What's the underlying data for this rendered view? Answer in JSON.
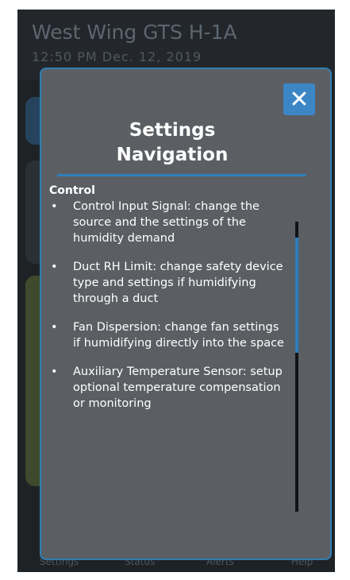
{
  "header": {
    "title": "West Wing GTS H-1A",
    "datetime": "12:50 PM Dec. 12, 2019"
  },
  "nav": {
    "items": [
      "Settings",
      "Status",
      "Alerts",
      "Help"
    ]
  },
  "modal": {
    "close_glyph": "✕",
    "title_line1": "Settings",
    "title_line2": "Navigation",
    "section_label": "Control",
    "items": [
      {
        "text": "Control Input Signal: change the source and the settings of the humidity demand"
      },
      {
        "text": "Duct RH Limit: change safety device type and settings if humidifying through a duct"
      },
      {
        "text": "Fan Dispersion: change fan settings if humidifying directly into the space"
      },
      {
        "text": "Auxiliary Temperature Sensor: setup optional temperature compensation or monitoring"
      }
    ],
    "bullet": "•"
  },
  "colors": {
    "accent": "#2d7fbd",
    "modal_bg": "#5b5f63",
    "close_bg": "#3d86c6",
    "app_bg": "#1f2225"
  }
}
